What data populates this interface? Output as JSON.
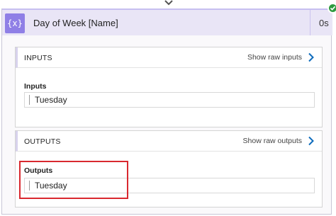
{
  "action": {
    "title": "Day of Week [Name]",
    "duration": "0s",
    "icon": "variable-curly-braces-icon",
    "status": "succeeded",
    "accent_color": "#8f7fe6",
    "status_color": "#2e9a3f"
  },
  "inputs": {
    "section_title": "INPUTS",
    "raw_link_label": "Show raw inputs",
    "field_label": "Inputs",
    "field_value": "Tuesday"
  },
  "outputs": {
    "section_title": "OUTPUTS",
    "raw_link_label": "Show raw outputs",
    "field_label": "Outputs",
    "field_value": "Tuesday"
  },
  "annotation": {
    "highlight_color": "#d9282f"
  }
}
